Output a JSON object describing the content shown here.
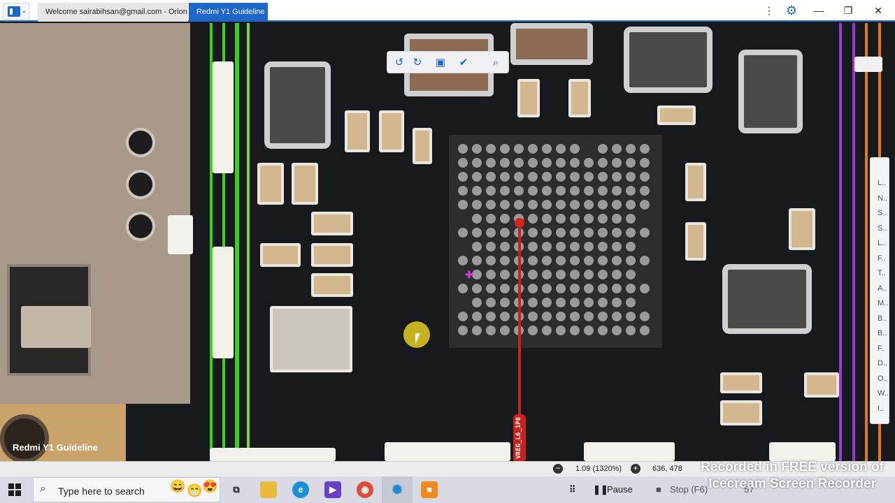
{
  "window": {
    "tabs": [
      {
        "label": "Welcome sairabihsan@gmail.com - Orion",
        "active": false
      },
      {
        "label": "Redmi Y1 Guideline",
        "active": true
      }
    ],
    "controls": {
      "menu": "⋮",
      "settings": "⚙",
      "minimize": "—",
      "maximize": "❐",
      "close": "✕"
    }
  },
  "toolbar": {
    "rotate_left": "↺",
    "rotate_right": "↻",
    "fit": "▣",
    "draw": "✔",
    "zoom": "⌕"
  },
  "board": {
    "watermark": "Redmi Y1 Guideline",
    "probe_label": "VREG_L6_1P8"
  },
  "side_panel": {
    "items": [
      "L..",
      "N..",
      "S..",
      "S..",
      "L..",
      "F..",
      "T..",
      "A..",
      "M..",
      "B..",
      "B..",
      "F..",
      "D..",
      "O..",
      "W..",
      "I.."
    ]
  },
  "status": {
    "zoom": "1.09 (1320%)",
    "coords": "636, 478"
  },
  "taskbar": {
    "search_placeholder": "Type here to search",
    "pause_label": "Pause",
    "stop_label": "Stop (F6)",
    "counter": "57"
  },
  "recorder_watermark": {
    "line1": "Recorded in FREE version of",
    "line2": "Icecream Screen Recorder"
  },
  "colors": {
    "accent": "#1e66c9",
    "probe_red": "#c9221c",
    "trace_green": "#3fcf1f",
    "trace_purple": "#9b37d6",
    "trace_orange": "#e27a1c"
  }
}
